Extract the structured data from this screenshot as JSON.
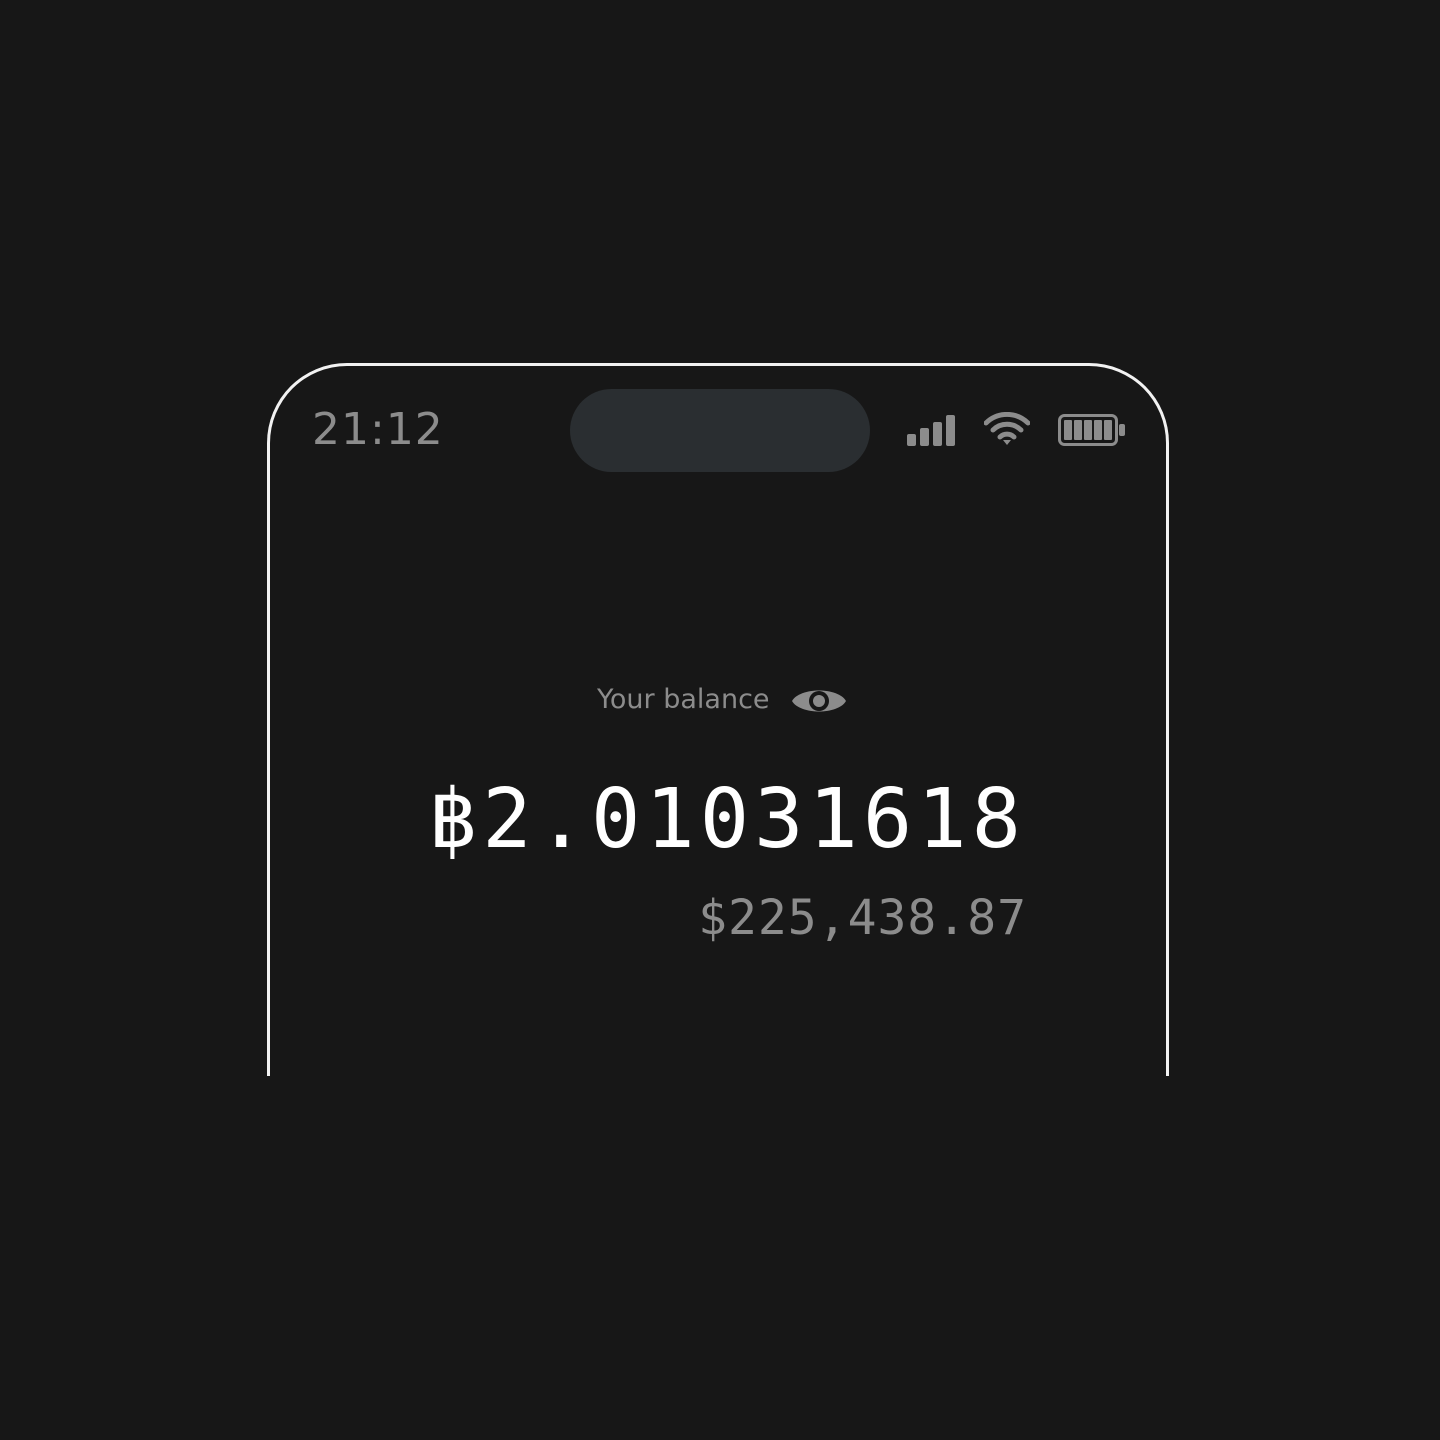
{
  "status_bar": {
    "time": "21:12",
    "signal_icon": "cellular-signal-icon",
    "wifi_icon": "wifi-icon",
    "battery_icon": "battery-full-icon"
  },
  "balance": {
    "label": "Your balance",
    "visibility_icon": "eye-icon",
    "btc_amount": "฿2.01031618",
    "usd_amount": "$225,438.87"
  },
  "colors": {
    "background": "#171717",
    "frame": "#f2f2f2",
    "primary_text": "#ffffff",
    "secondary_text": "#8c8c8c",
    "dynamic_island": "#2a2e31"
  }
}
